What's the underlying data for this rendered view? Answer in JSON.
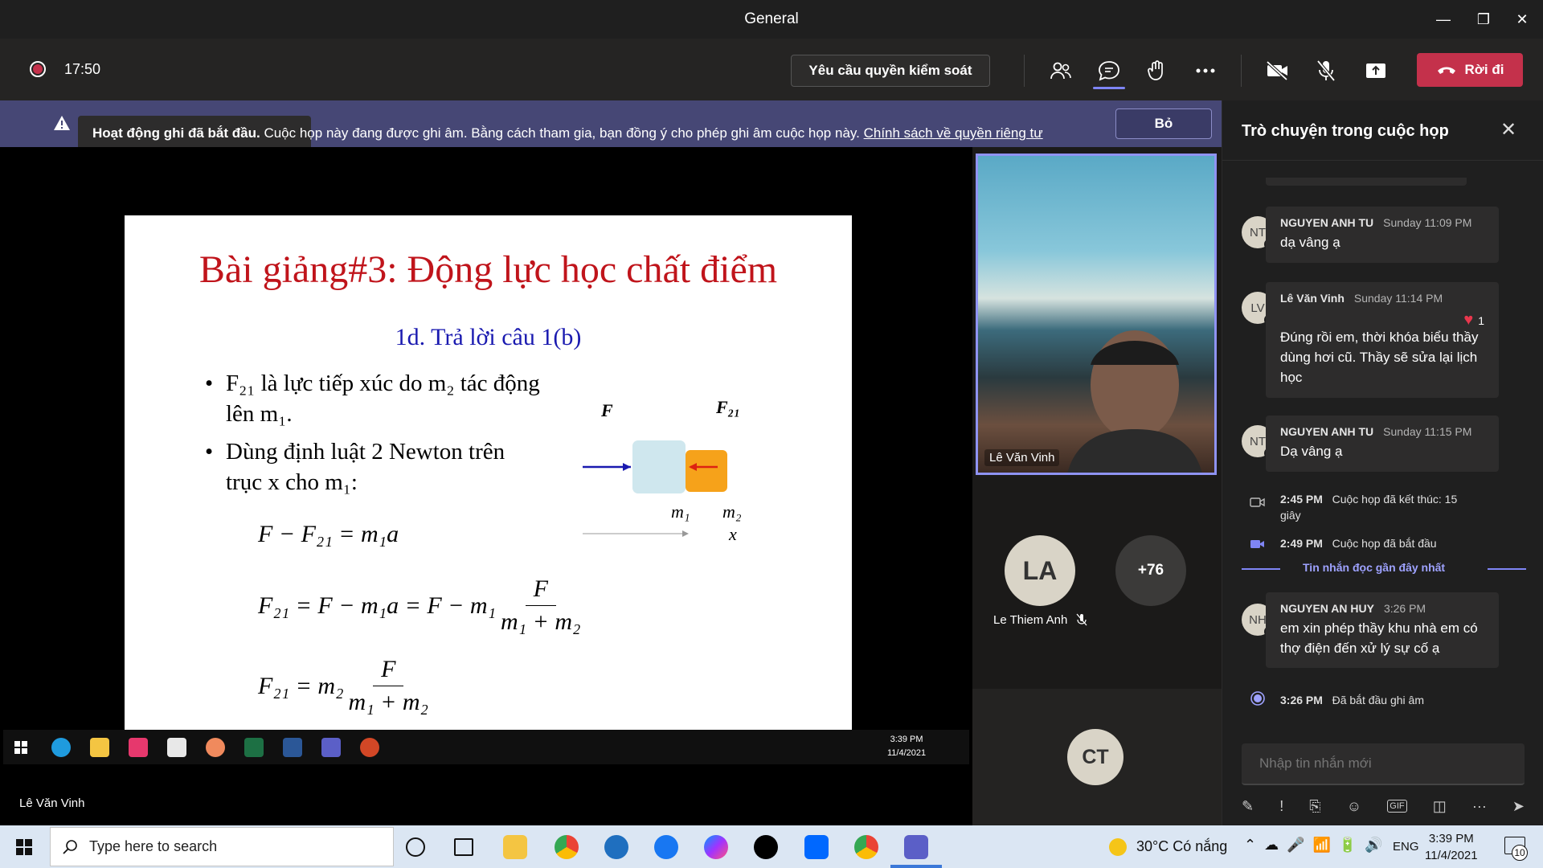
{
  "window": {
    "title": "General",
    "minimize": "—",
    "restore": "❐",
    "close": "✕"
  },
  "toolbar": {
    "timer": "17:50",
    "request_control": "Yêu cầu quyền kiểm soát",
    "leave": "Rời đi"
  },
  "banner": {
    "bold": "Hoạt động ghi đã bắt đầu.",
    "text": " Cuộc họp này đang được ghi âm. Bằng cách tham gia, bạn đồng ý cho phép ghi âm cuộc họp này. ",
    "link": "Chính sách về quyền riêng tư",
    "dismiss": "Bỏ"
  },
  "slide": {
    "title": "Bài giảng#3: Động lực học chất điểm",
    "subtitle": "1d. Trả lời câu 1(b)",
    "bullet1": "F₂₁ là lực tiếp xúc do m₂ tác động lên m₁.",
    "bullet2": "Dùng định luật 2 Newton trên trục x cho m₁:",
    "eq1": "F − F₂₁ = m₁a",
    "eq2_left": "F₂₁ = F − m₁a = F − m₁",
    "eq2_num": "F",
    "eq2_den": "m₁ + m₂",
    "eq3_left": "F₂₁ = m₂",
    "eq3_num": "F",
    "eq3_den": "m₁ + m₂",
    "diagram": {
      "force_left": "F",
      "force_right": "F₂₁",
      "mass1": "m₁",
      "mass2": "m₂",
      "axis": "x"
    }
  },
  "shared_taskbar": {
    "time": "3:39 PM",
    "date": "11/4/2021"
  },
  "stage_presenter": "Lê Văn Vinh",
  "participants": {
    "video_name": "Lê Văn Vinh",
    "la_initials": "LA",
    "la_name": "Le Thiem Anh",
    "more": "+76",
    "ct_initials": "CT"
  },
  "chat": {
    "title": "Trò chuyện trong cuộc họp",
    "messages": [
      {
        "initials": "NT",
        "name": "NGUYEN ANH TU",
        "time": "Sunday 11:09 PM",
        "text": "dạ vâng ạ"
      },
      {
        "initials": "LV",
        "name": "Lê Văn Vinh",
        "time": "Sunday 11:14 PM",
        "reaction": "1",
        "text": "Đúng rồi em, thời khóa biểu thầy dùng hơi cũ. Thầy sẽ sửa lại lịch học"
      },
      {
        "initials": "NT",
        "name": "NGUYEN ANH TU",
        "time": "Sunday 11:15 PM",
        "text": "Dạ vâng ạ"
      },
      {
        "initials": "NH",
        "name": "NGUYEN AN HUY",
        "time": "3:26 PM",
        "text": "em xin phép thầy khu nhà em có thợ điện đến xử lý sự cố ạ"
      }
    ],
    "events": [
      {
        "time": "2:45 PM",
        "text": "Cuộc họp đã kết thúc: 15 giây"
      },
      {
        "time": "2:49 PM",
        "text": "Cuộc họp đã bắt đầu"
      },
      {
        "time": "3:26 PM",
        "text": "Đã bắt đầu ghi âm"
      }
    ],
    "last_read": "Tin nhắn đọc gần đây nhất",
    "compose_placeholder": "Nhập tin nhắn mới"
  },
  "taskbar": {
    "search_placeholder": "Type here to search",
    "weather": "30°C  Có nắng",
    "lang": "ENG",
    "time": "3:39 PM",
    "date": "11/4/2021",
    "notif": "10"
  },
  "colors": {
    "accent": "#7f85f5",
    "leave": "#c4314b",
    "banner": "#464775",
    "slide_title": "#c0141b",
    "slide_sub": "#1a1ab0"
  }
}
